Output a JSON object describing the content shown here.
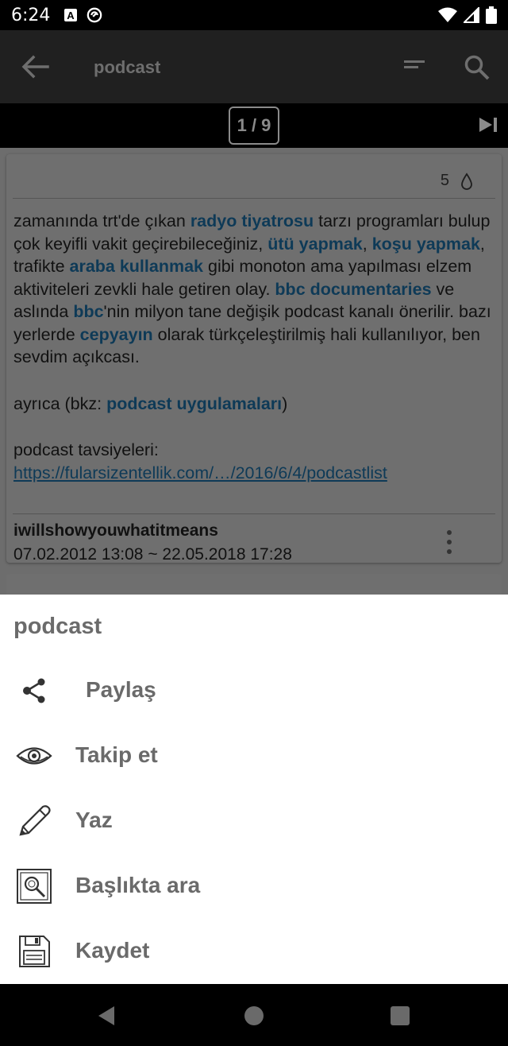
{
  "status_bar": {
    "time": "6:24"
  },
  "app_bar": {
    "title": "podcast"
  },
  "pager": {
    "label": "1 / 9"
  },
  "entry": {
    "favorites_count": "5",
    "paragraph1": [
      {
        "t": "zamanında trt'de çıkan ",
        "link": false
      },
      {
        "t": "radyo tiyatrosu",
        "link": true
      },
      {
        "t": " tarzı programları bulup çok keyifli vakit geçirebileceğiniz, ",
        "link": false
      },
      {
        "t": "ütü yapmak",
        "link": true
      },
      {
        "t": ", ",
        "link": false
      },
      {
        "t": "koşu yapmak",
        "link": true
      },
      {
        "t": ", trafikte ",
        "link": false
      },
      {
        "t": "araba kullanmak",
        "link": true
      },
      {
        "t": " gibi monoton ama yapılması elzem aktiviteleri zevkli hale getiren olay. ",
        "link": false
      },
      {
        "t": "bbc documentaries",
        "link": true
      },
      {
        "t": " ve aslında ",
        "link": false
      },
      {
        "t": "bbc",
        "link": true
      },
      {
        "t": "'nin milyon tane değişik podcast kanalı önerilir. bazı yerlerde ",
        "link": false
      },
      {
        "t": "cepyayın",
        "link": true
      },
      {
        "t": " olarak türkçeleştirilmiş hali kullanılıyor, ben sevdim açıkcası.",
        "link": false
      }
    ],
    "paragraph2_prefix": "ayrıca (bkz: ",
    "paragraph2_link": "podcast uygulamaları",
    "paragraph2_suffix": ")",
    "paragraph3_prefix": "podcast tavsiyeleri: ",
    "paragraph3_url": "https://fularsizentellik.com/…/2016/6/4/podcastlist",
    "author": "iwillshowyouwhatitmeans",
    "dates": "07.02.2012 13:08 ~ 22.05.2018 17:28"
  },
  "sheet": {
    "title": "podcast",
    "items": [
      {
        "label": "Paylaş",
        "icon": "share-icon"
      },
      {
        "label": "Takip et",
        "icon": "eye-icon"
      },
      {
        "label": "Yaz",
        "icon": "pencil-icon"
      },
      {
        "label": "Başlıkta ara",
        "icon": "search-in-title-icon"
      },
      {
        "label": "Kaydet",
        "icon": "save-icon"
      }
    ]
  },
  "colors": {
    "link": "#0e3a57",
    "sheet_text": "#6a6a6a",
    "overlay_bg": "#6d6d6d"
  }
}
